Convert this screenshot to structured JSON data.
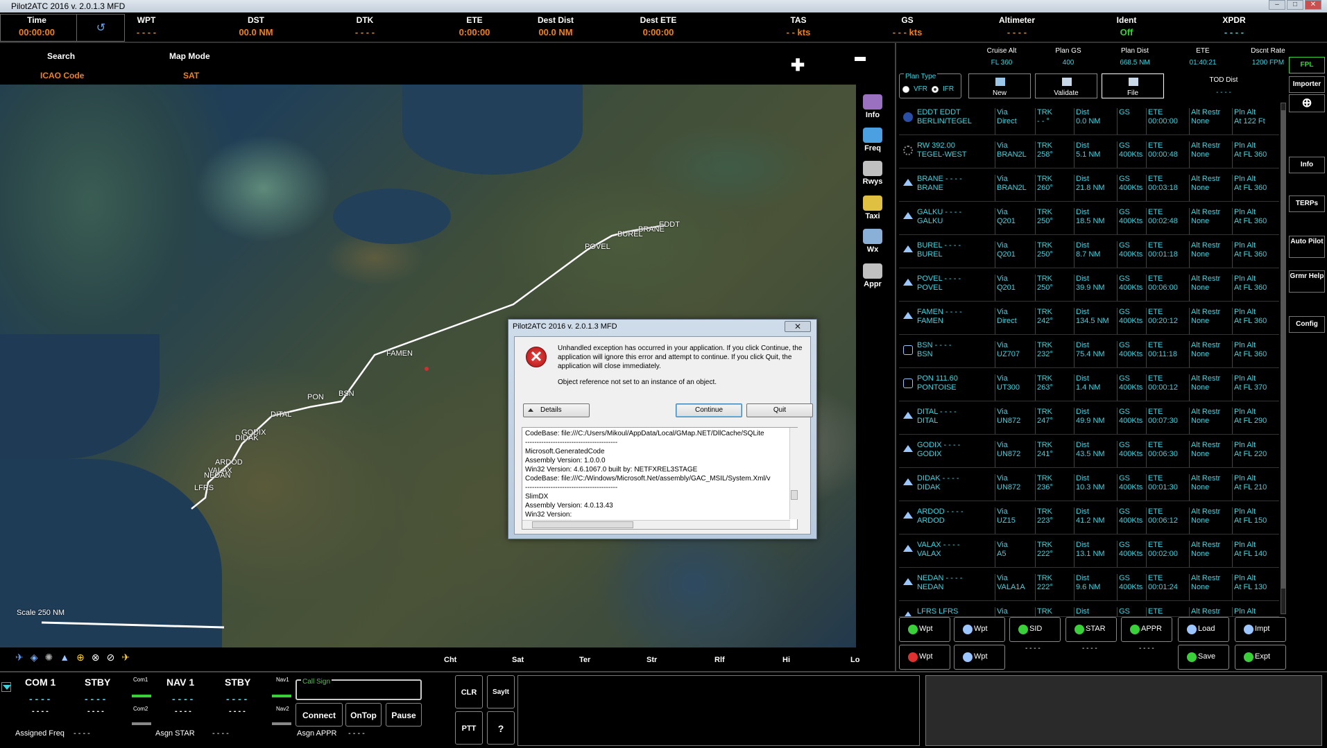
{
  "window": {
    "title": "Pilot2ATC 2016 v. 2.0.1.3 MFD"
  },
  "topbar": {
    "time": {
      "label": "Time",
      "value": "00:00:00"
    },
    "items": [
      {
        "label": "WPT",
        "value": "- - - -",
        "color": "#f0801a"
      },
      {
        "label": "DST",
        "value": "00.0 NM",
        "color": "#f0801a"
      },
      {
        "label": "DTK",
        "value": "- - - -",
        "color": "#f0801a"
      },
      {
        "label": "ETE",
        "value": "0:00:00",
        "color": "#f0801a"
      },
      {
        "label": "Dest Dist",
        "value": "00.0 NM",
        "color": "#f0801a"
      },
      {
        "label": "Dest ETE",
        "value": "0:00:00",
        "color": "#f0801a"
      },
      {
        "label": "TAS",
        "value": "- - kts",
        "color": "#f0801a"
      },
      {
        "label": "GS",
        "value": "- - - kts",
        "color": "#f0801a"
      },
      {
        "label": "Altimeter",
        "value": "- - - -",
        "color": "#f0801a"
      },
      {
        "label": "Ident",
        "value": "Off",
        "color": "#3ad03a"
      },
      {
        "label": "XPDR",
        "value": "- - - -",
        "color": "#3fd3e0"
      }
    ]
  },
  "map": {
    "search_label": "Search",
    "search_value": "ICAO Code",
    "mode_label": "Map Mode",
    "mode_value": "SAT",
    "scale": "Scale 250 NM",
    "waypoints": [
      "EDDT",
      "BRANE",
      "GALKU",
      "BUREL",
      "POVEL",
      "FAMEN",
      "BSN",
      "PON",
      "DITAL",
      "GODIX",
      "DIDAK",
      "ARDOD",
      "VALAX",
      "NEDAN",
      "LFRS"
    ],
    "side_buttons": [
      "Info",
      "Freq",
      "Rwys",
      "Taxi",
      "Wx",
      "Appr"
    ],
    "bottom_labels": [
      "Cht",
      "Sat",
      "Ter",
      "Str",
      "Rlf",
      "Hi",
      "Lo"
    ]
  },
  "fpl": {
    "header": [
      {
        "label": "Cruise Alt",
        "value": "FL 360"
      },
      {
        "label": "Plan GS",
        "value": "400"
      },
      {
        "label": "Plan Dist",
        "value": "668.5 NM"
      },
      {
        "label": "ETE",
        "value": "01:40:21"
      },
      {
        "label": "Dscnt Rate",
        "value": "1200 FPM"
      }
    ],
    "tod_label": "TOD Dist",
    "tod_value": "- - - -",
    "plan_type_label": "Plan Type",
    "vfr": "VFR",
    "ifr": "IFR",
    "buttons": {
      "new": "New",
      "validate": "Validate",
      "file": "File"
    },
    "rows": [
      {
        "id": "EDDT  EDDT",
        "name": "BERLIN/TEGEL",
        "via": "Direct",
        "trk": "- - °",
        "dist": "0.0 NM",
        "gs": "",
        "ete": "00:00:00",
        "alt": "None",
        "pln": "At 122 Ft"
      },
      {
        "id": "RW  392.00",
        "name": "TEGEL-WEST",
        "via": "BRAN2L",
        "trk": "258°",
        "dist": "5.1 NM",
        "gs": "400Kts",
        "ete": "00:00:48",
        "alt": "None",
        "pln": "At FL 360"
      },
      {
        "id": "BRANE  - - - -",
        "name": "BRANE",
        "via": "BRAN2L",
        "trk": "260°",
        "dist": "21.8 NM",
        "gs": "400Kts",
        "ete": "00:03:18",
        "alt": "None",
        "pln": "At FL 360"
      },
      {
        "id": "GALKU  - - - -",
        "name": "GALKU",
        "via": "Q201",
        "trk": "250°",
        "dist": "18.5 NM",
        "gs": "400Kts",
        "ete": "00:02:48",
        "alt": "None",
        "pln": "At FL 360"
      },
      {
        "id": "BUREL  - - - -",
        "name": "BUREL",
        "via": "Q201",
        "trk": "250°",
        "dist": "8.7 NM",
        "gs": "400Kts",
        "ete": "00:01:18",
        "alt": "None",
        "pln": "At FL 360"
      },
      {
        "id": "POVEL  - - - -",
        "name": "POVEL",
        "via": "Q201",
        "trk": "250°",
        "dist": "39.9 NM",
        "gs": "400Kts",
        "ete": "00:06:00",
        "alt": "None",
        "pln": "At FL 360"
      },
      {
        "id": "FAMEN  - - - -",
        "name": "FAMEN",
        "via": "Direct",
        "trk": "242°",
        "dist": "134.5 NM",
        "gs": "400Kts",
        "ete": "00:20:12",
        "alt": "None",
        "pln": "At FL 360"
      },
      {
        "id": "BSN  - - - -",
        "name": "BSN",
        "via": "UZ707",
        "trk": "232°",
        "dist": "75.4 NM",
        "gs": "400Kts",
        "ete": "00:11:18",
        "alt": "None",
        "pln": "At FL 360"
      },
      {
        "id": "PON  111.60",
        "name": "PONTOISE",
        "via": "UT300",
        "trk": "263°",
        "dist": "1.4 NM",
        "gs": "400Kts",
        "ete": "00:00:12",
        "alt": "None",
        "pln": "At FL 370"
      },
      {
        "id": "DITAL  - - - -",
        "name": "DITAL",
        "via": "UN872",
        "trk": "247°",
        "dist": "49.9 NM",
        "gs": "400Kts",
        "ete": "00:07:30",
        "alt": "None",
        "pln": "At FL 290"
      },
      {
        "id": "GODIX  - - - -",
        "name": "GODIX",
        "via": "UN872",
        "trk": "241°",
        "dist": "43.5 NM",
        "gs": "400Kts",
        "ete": "00:06:30",
        "alt": "None",
        "pln": "At FL 220"
      },
      {
        "id": "DIDAK  - - - -",
        "name": "DIDAK",
        "via": "UN872",
        "trk": "236°",
        "dist": "10.3 NM",
        "gs": "400Kts",
        "ete": "00:01:30",
        "alt": "None",
        "pln": "At FL 210"
      },
      {
        "id": "ARDOD  - - - -",
        "name": "ARDOD",
        "via": "UZ15",
        "trk": "223°",
        "dist": "41.2 NM",
        "gs": "400Kts",
        "ete": "00:06:12",
        "alt": "None",
        "pln": "At FL 150"
      },
      {
        "id": "VALAX  - - - -",
        "name": "VALAX",
        "via": "A5",
        "trk": "222°",
        "dist": "13.1 NM",
        "gs": "400Kts",
        "ete": "00:02:00",
        "alt": "None",
        "pln": "At FL 140"
      },
      {
        "id": "NEDAN  - - - -",
        "name": "NEDAN",
        "via": "VALA1A",
        "trk": "222°",
        "dist": "9.6 NM",
        "gs": "400Kts",
        "ete": "00:01:24",
        "alt": "None",
        "pln": "At FL 130"
      },
      {
        "id": "LFRS  LFRS",
        "name": "",
        "via": "Via",
        "trk": "TRK",
        "dist": "Dist",
        "gs": "GS",
        "ete": "ETE",
        "alt": "Alt Restr",
        "pln": "Pln Alt"
      }
    ],
    "col_labels": {
      "via": "Via",
      "trk": "TRK",
      "dist": "Dist",
      "gs": "GS",
      "ete": "ETE",
      "alt": "Alt Restr",
      "pln": "Pln Alt"
    },
    "actions_row1": [
      "Wpt",
      "Wpt",
      "SID",
      "STAR",
      "APPR",
      "Load",
      "Impt"
    ],
    "actions_row2": [
      "Wpt",
      "Wpt",
      "Save",
      "Expt"
    ],
    "dashes": "- - - -"
  },
  "right_side": [
    "FPL",
    "Importer",
    "Info",
    "TERPs",
    "Auto Pilot",
    "Grmr Help",
    "Config"
  ],
  "radio": {
    "com1": "COM 1",
    "stby": "STBY",
    "nav1": "NAV 1",
    "stby2": "STBY",
    "com1_val": "- - - -",
    "stby_val": "- - - -",
    "nav1_val": "- - - -",
    "stby2_val": "- - - -",
    "com1_sub": "- - - -",
    "stby_sub": "- - - -",
    "nav1_sub": "- - - -",
    "stby2_sub": "- - - -",
    "com1_small": "Com1",
    "com2_small": "Com2",
    "nav1_small": "Nav1",
    "nav2_small": "Nav2",
    "assigned_freq": "Assigned Freq",
    "assigned_freq_val": "- - - -",
    "asgn_star": "Asgn STAR",
    "asgn_star_val": "- - - -",
    "asgn_appr": "Asgn APPR",
    "asgn_appr_val": "- - - -",
    "callsign": "Call Sign",
    "connect": "Connect",
    "ontop": "OnTop",
    "pause": "Pause",
    "clr": "CLR",
    "sayit": "SayIt",
    "ptt": "PTT",
    "help": "?"
  },
  "dialog": {
    "title": "Pilot2ATC 2016 v. 2.0.1.3 MFD",
    "close": "✕",
    "message1": "Unhandled exception has occurred in your application. If you click Continue, the application will ignore this error and attempt to continue. If you click Quit, the application will close immediately.",
    "message2": "Object reference not set to an instance of an object.",
    "details": "Details",
    "continue": "Continue",
    "quit": "Quit",
    "log": [
      "   CodeBase: file:///C:/Users/Mikoul/AppData/Local/GMap.NET/DllCache/SQLite",
      "----------------------------------------",
      "Microsoft.GeneratedCode",
      "    Assembly Version: 1.0.0.0",
      "    Win32 Version: 4.6.1067.0 built by: NETFXREL3STAGE",
      "    CodeBase: file:///C:/Windows/Microsoft.Net/assembly/GAC_MSIL/System.Xml/v",
      "----------------------------------------",
      "SlimDX",
      "    Assembly Version: 4.0.13.43",
      "    Win32 Version:"
    ]
  }
}
